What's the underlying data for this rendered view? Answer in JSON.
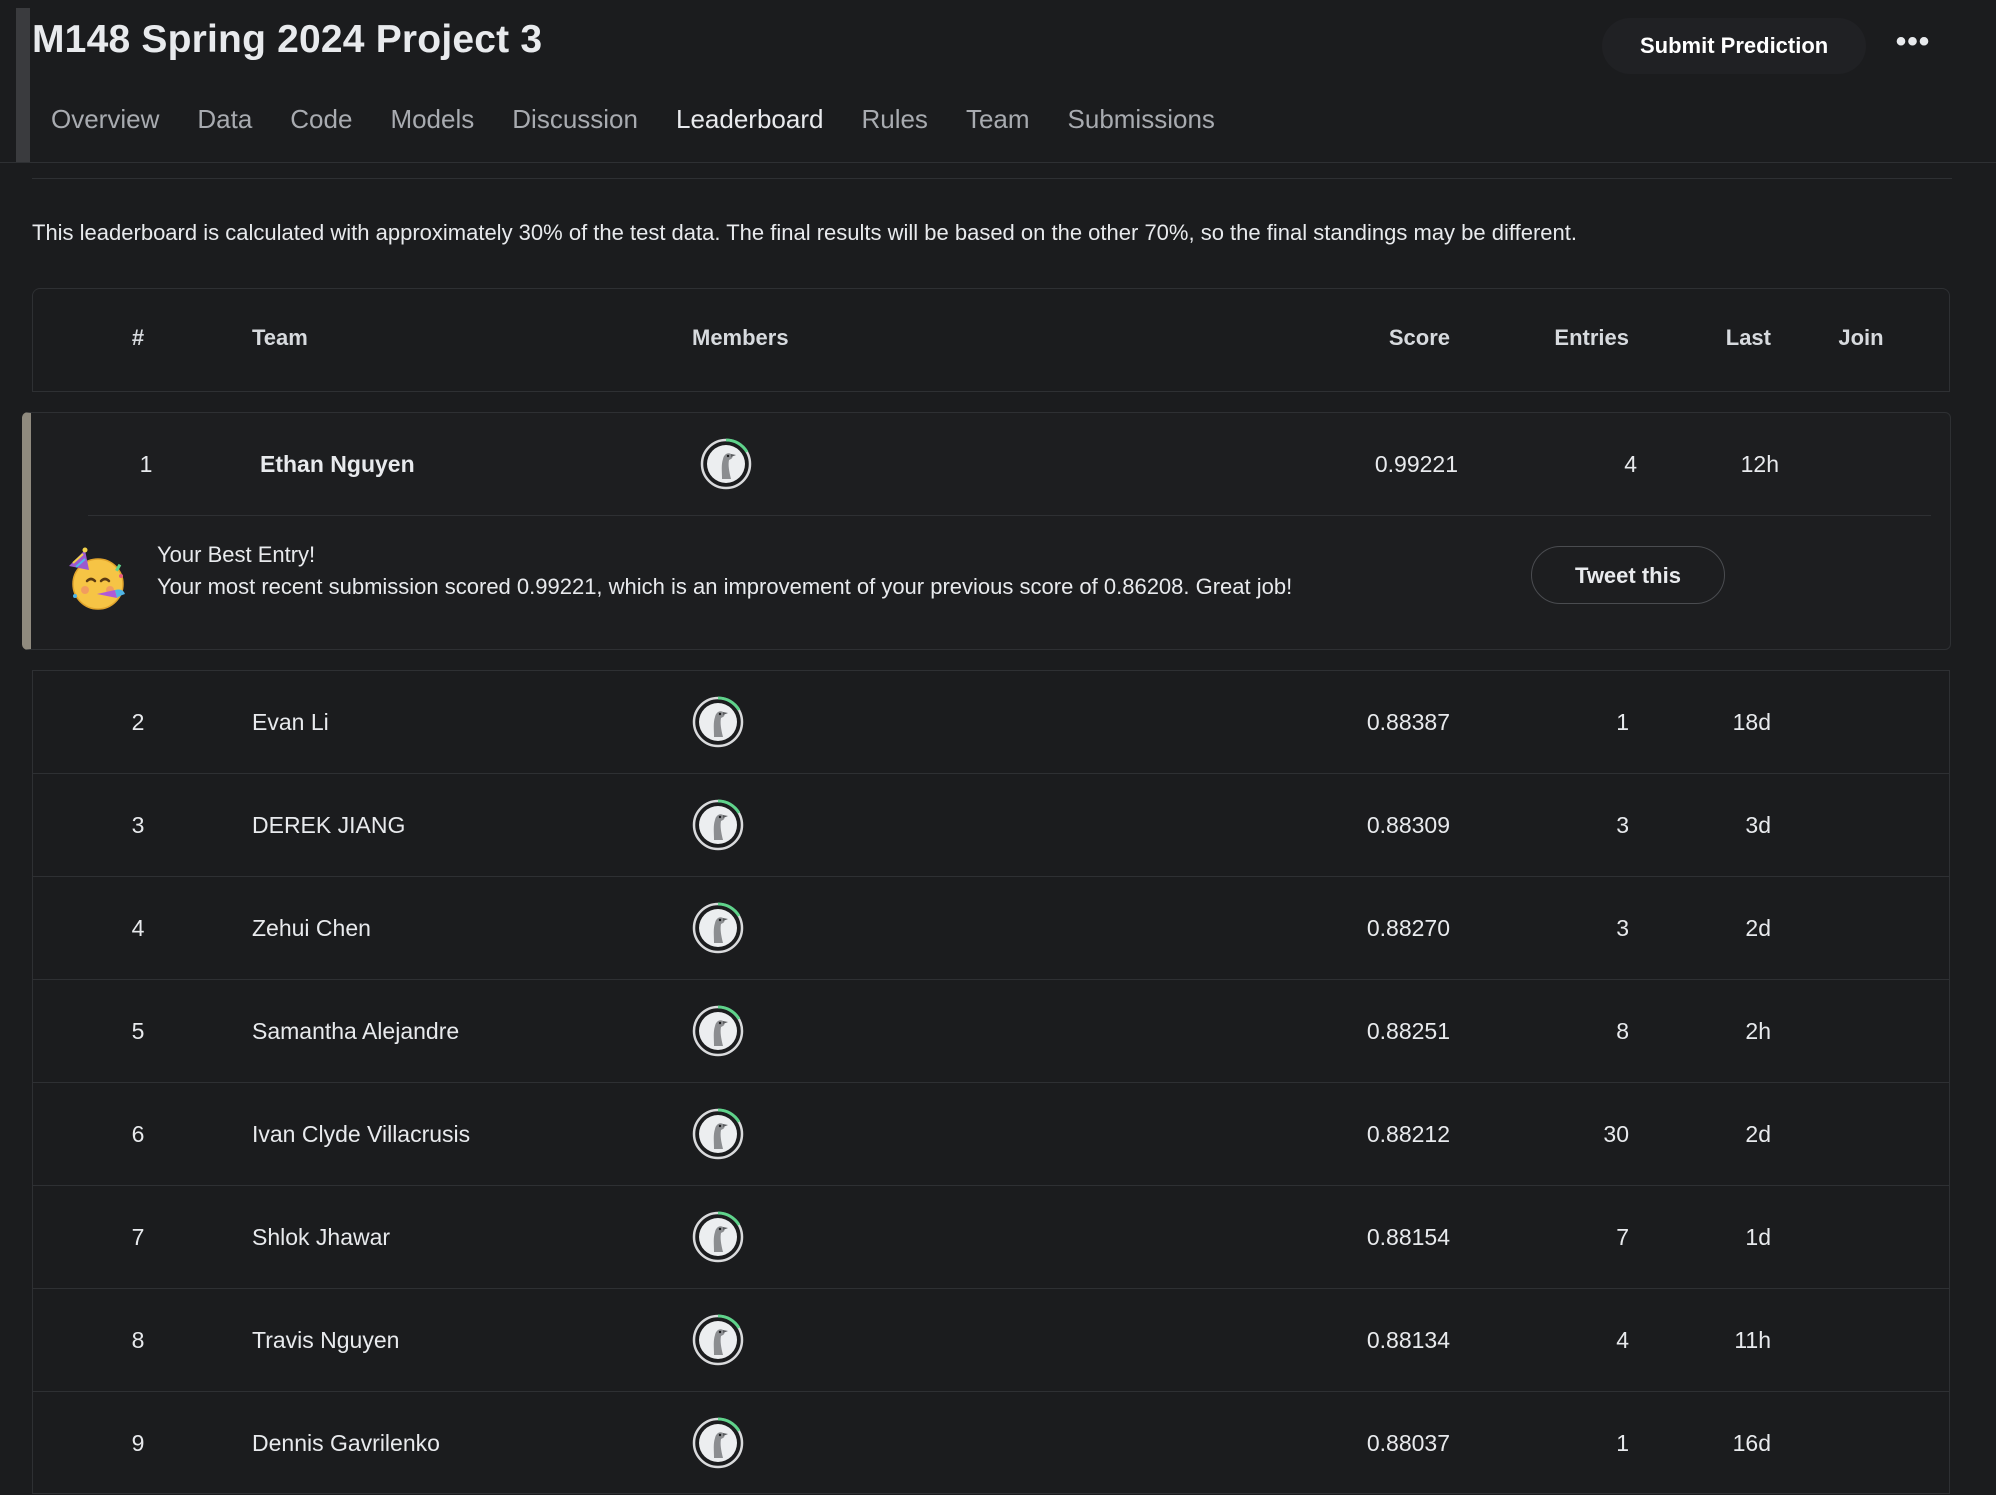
{
  "header": {
    "title": "M148 Spring 2024 Project 3",
    "submit_label": "Submit Prediction",
    "more_label": "•••"
  },
  "tabs": [
    {
      "label": "Overview"
    },
    {
      "label": "Data"
    },
    {
      "label": "Code"
    },
    {
      "label": "Models"
    },
    {
      "label": "Discussion"
    },
    {
      "label": "Leaderboard"
    },
    {
      "label": "Rules"
    },
    {
      "label": "Team"
    },
    {
      "label": "Submissions"
    }
  ],
  "active_tab": "Leaderboard",
  "notice": "This leaderboard is calculated with approximately 30% of the test data. The final results will be based on the other 70%, so the final standings may be different.",
  "table": {
    "columns": {
      "rank": "#",
      "team": "Team",
      "members": "Members",
      "score": "Score",
      "entries": "Entries",
      "last": "Last",
      "join": "Join"
    },
    "best_entry": {
      "rank": "1",
      "team": "Ethan Nguyen",
      "score": "0.99221",
      "entries": "4",
      "last": "12h",
      "message_title": "Your Best Entry!",
      "message_body": "Your most recent submission scored 0.99221, which is an improvement of your previous score of 0.86208. Great job!",
      "tweet_label": "Tweet this"
    },
    "rows": [
      {
        "rank": "2",
        "team": "Evan Li",
        "score": "0.88387",
        "entries": "1",
        "last": "18d"
      },
      {
        "rank": "3",
        "team": "DEREK JIANG",
        "score": "0.88309",
        "entries": "3",
        "last": "3d"
      },
      {
        "rank": "4",
        "team": "Zehui Chen",
        "score": "0.88270",
        "entries": "3",
        "last": "2d"
      },
      {
        "rank": "5",
        "team": "Samantha Alejandre",
        "score": "0.88251",
        "entries": "8",
        "last": "2h"
      },
      {
        "rank": "6",
        "team": "Ivan Clyde Villacrusis",
        "score": "0.88212",
        "entries": "30",
        "last": "2d"
      },
      {
        "rank": "7",
        "team": "Shlok Jhawar",
        "score": "0.88154",
        "entries": "7",
        "last": "1d"
      },
      {
        "rank": "8",
        "team": "Travis Nguyen",
        "score": "0.88134",
        "entries": "4",
        "last": "11h"
      },
      {
        "rank": "9",
        "team": "Dennis Gavrilenko",
        "score": "0.88037",
        "entries": "1",
        "last": "16d"
      }
    ]
  },
  "colors": {
    "background": "#1b1c1e",
    "border": "#2e3033",
    "text": "#e8eaed",
    "muted_text": "#a8abb0",
    "avatar_ring": "#5fd38b",
    "best_accent": "#8f8a7e"
  },
  "icons": {
    "avatar": "default-goose-avatar-icon",
    "emoji": "partying-face-emoji-icon",
    "more": "ellipsis-icon"
  }
}
